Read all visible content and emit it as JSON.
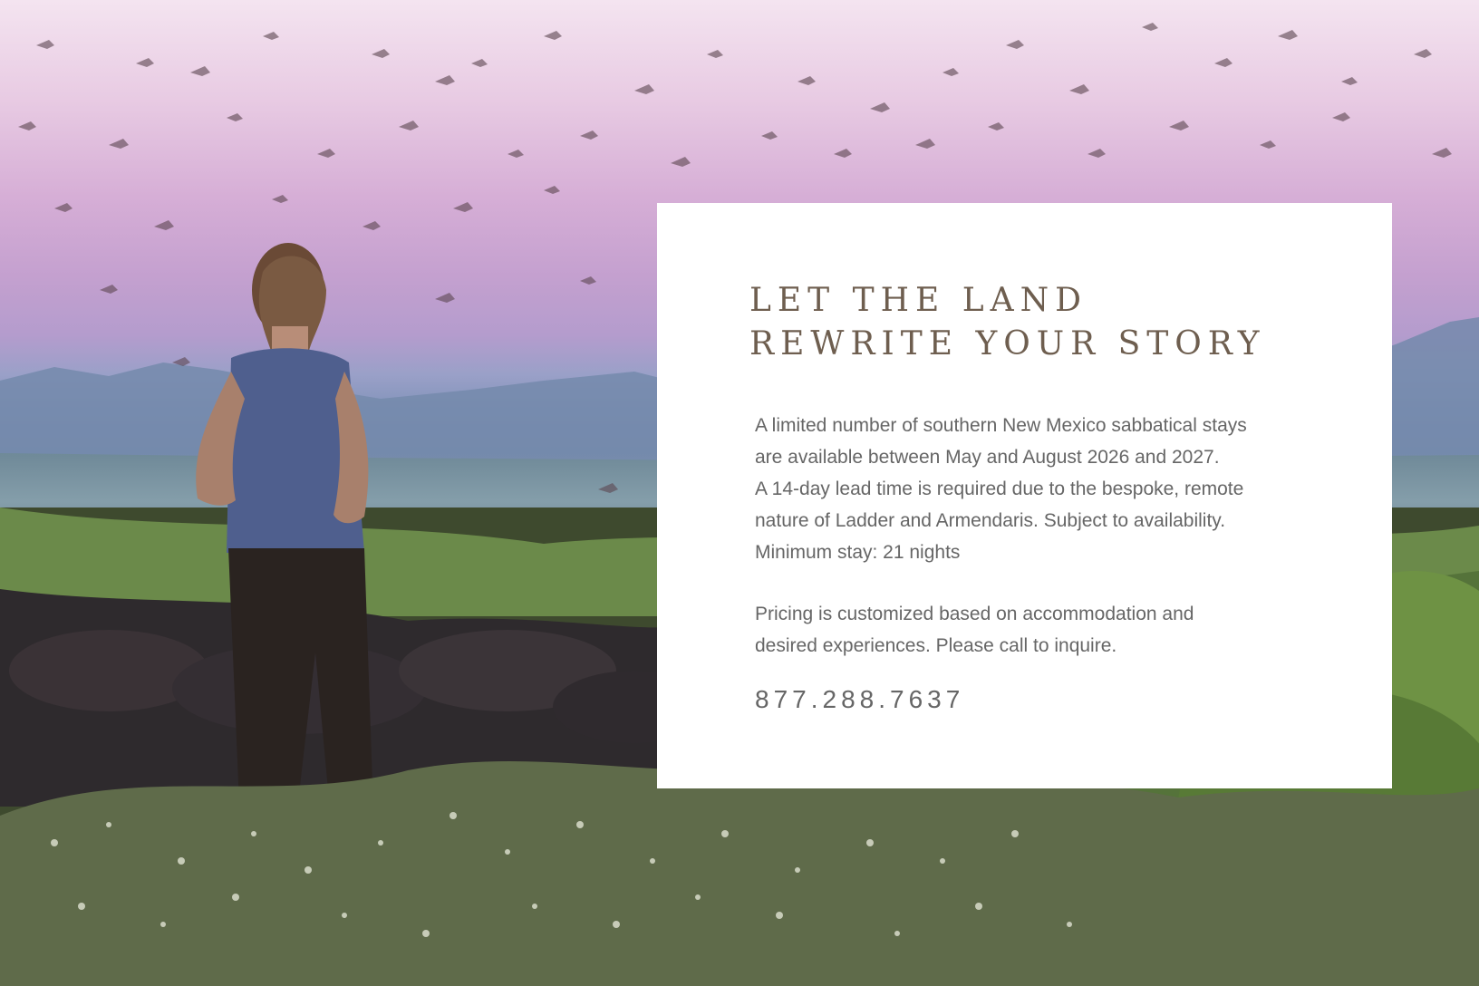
{
  "card": {
    "headline_line1": "LET THE LAND",
    "headline_line2": "REWRITE YOUR STORY",
    "body_lines": [
      "A limited number of southern New Mexico sabbatical stays",
      "are available between May and August 2026 and 2027.",
      "A 14-day lead time is required due to the bespoke, remote",
      "nature of Ladder and Armendaris. Subject to availability.",
      "Minimum stay: 21 nights"
    ],
    "pricing_lines": [
      "Pricing is customized based on accommodation and",
      "desired experiences. Please call to inquire."
    ],
    "phone": "877.288.7637"
  },
  "colors": {
    "headline": "#6e5e4f",
    "body_text": "#666666",
    "card_background": "#ffffff",
    "sky_top": "#f4e4f0",
    "sky_mid": "#c4a0cf",
    "mountains": "#6c82a0",
    "vegetation": "#5f7a3c"
  }
}
